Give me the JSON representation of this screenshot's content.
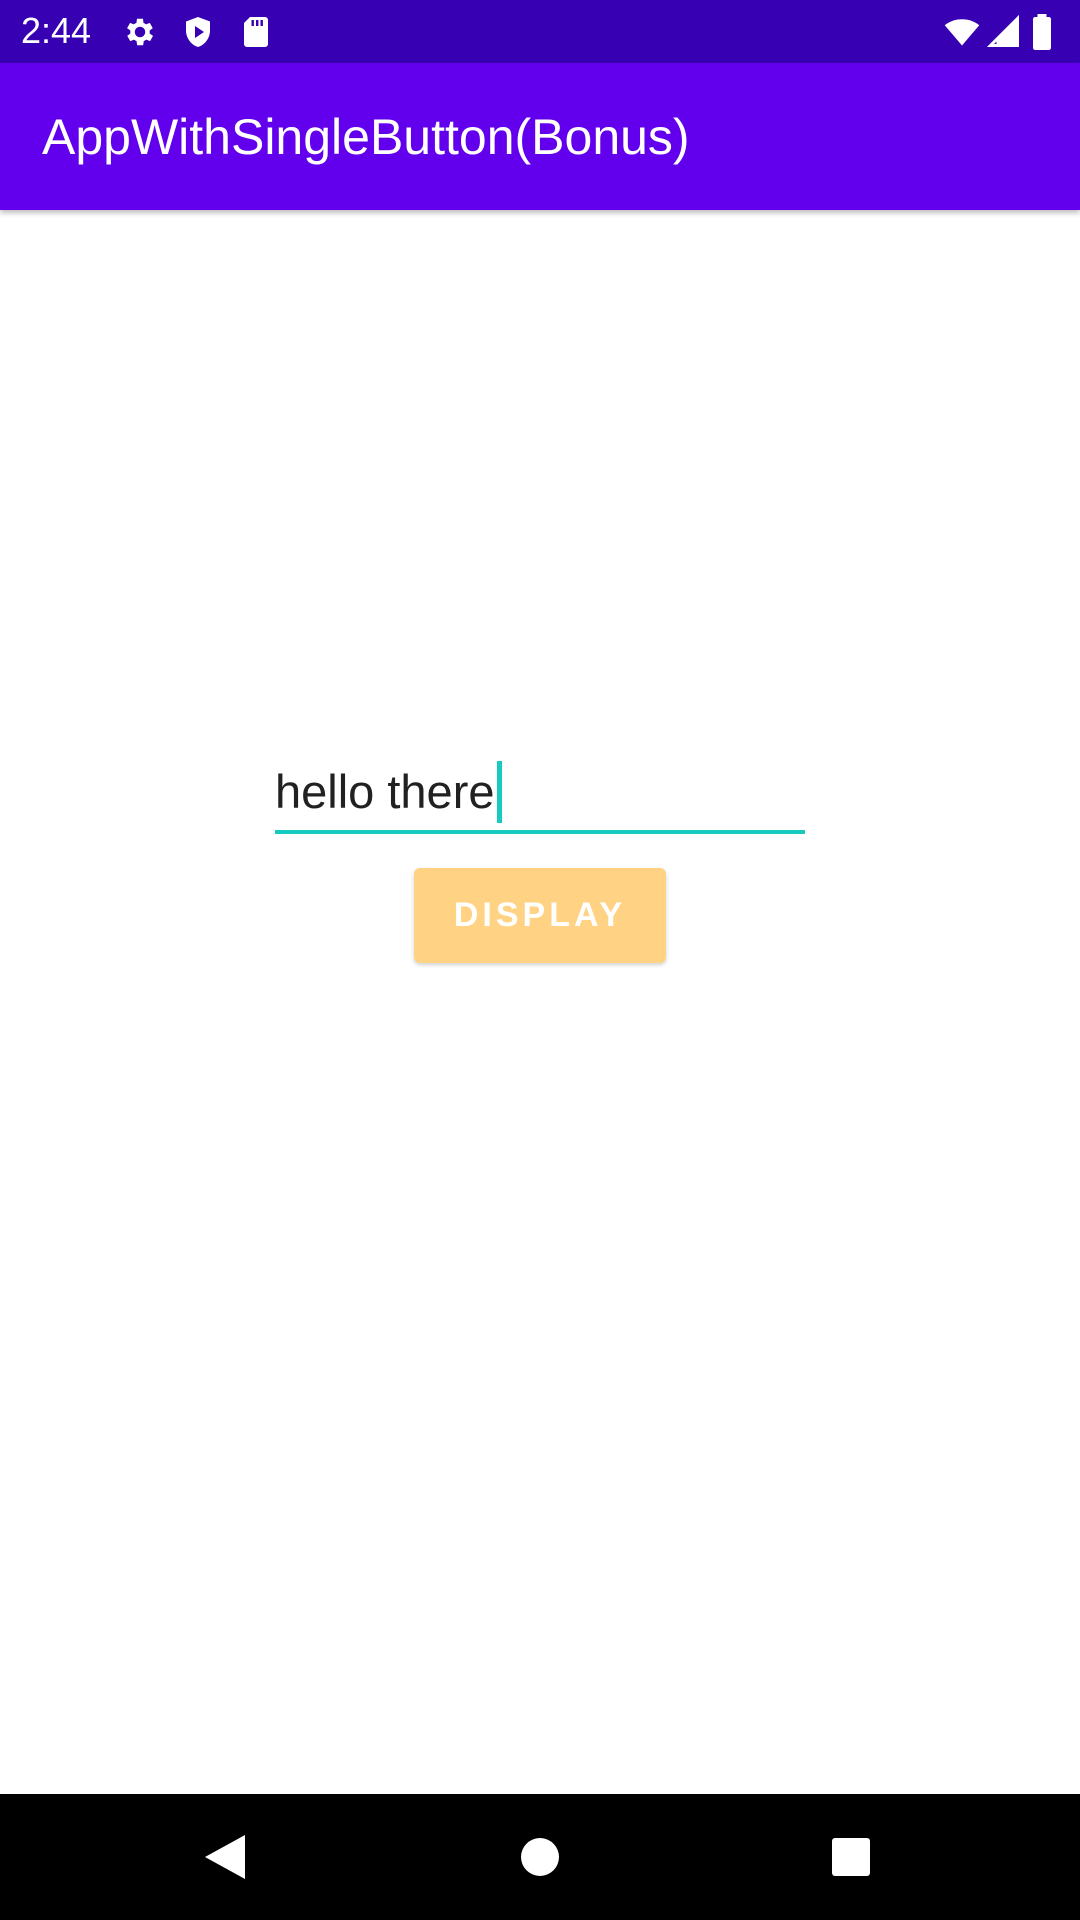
{
  "status_bar": {
    "time": "2:44",
    "left_icons": [
      "gear-icon",
      "play-protect-icon",
      "sd-card-icon"
    ],
    "right_icons": [
      "wifi-icon",
      "signal-icon",
      "battery-icon"
    ],
    "background": "#3700b3"
  },
  "app_bar": {
    "title": "AppWithSingleButton(Bonus)",
    "background": "#6200ee"
  },
  "main": {
    "input": {
      "value": "hello there",
      "accent_color": "#18cbc0"
    },
    "display_button": {
      "label": "DISPLAY",
      "background": "#ffd383"
    }
  },
  "nav_bar": {
    "buttons": [
      "back-icon",
      "home-icon",
      "recents-icon"
    ]
  }
}
